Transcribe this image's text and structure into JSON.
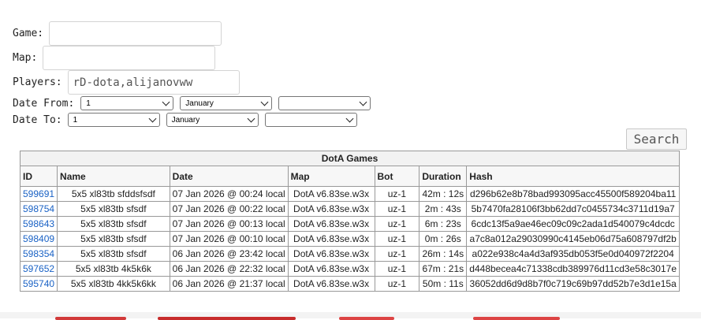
{
  "form": {
    "game_label": "Game:",
    "game_value": "",
    "map_label": "Map:",
    "map_value": "",
    "players_label": "Players:",
    "players_value": "rD-dota,alijanovww",
    "date_from_label": "Date From:",
    "date_from": {
      "day": "1",
      "month": "January",
      "year": ""
    },
    "date_to_label": "Date To:",
    "date_to": {
      "day": "1",
      "month": "January",
      "year": ""
    },
    "search_label": "Search"
  },
  "table": {
    "caption": "DotA Games",
    "headers": [
      "ID",
      "Name",
      "Date",
      "Map",
      "Bot",
      "Duration",
      "Hash"
    ],
    "rows": [
      {
        "id": "599691",
        "name": "5x5 xl83tb sfddsfsdf",
        "date": "07 Jan 2026 @ 00:24 local",
        "map": "DotA v6.83se.w3x",
        "bot": "uz-1",
        "duration": "42m : 12s",
        "hash": "d296b62e8b78bad993095acc45500f589204ba11"
      },
      {
        "id": "598754",
        "name": "5x5 xl83tb sfsdf",
        "date": "07 Jan 2026 @ 00:22 local",
        "map": "DotA v6.83se.w3x",
        "bot": "uz-1",
        "duration": "2m : 43s",
        "hash": "5b7470fa28106f3bb62dd7c0455734c3711d19a7"
      },
      {
        "id": "598643",
        "name": "5x5 xl83tb sfsdf",
        "date": "07 Jan 2026 @ 00:13 local",
        "map": "DotA v6.83se.w3x",
        "bot": "uz-1",
        "duration": "6m : 23s",
        "hash": "6cdc13f5a9ae46ec09c09c2ada1d540079c4dcdc"
      },
      {
        "id": "598409",
        "name": "5x5 xl83tb sfsdf",
        "date": "07 Jan 2026 @ 00:10 local",
        "map": "DotA v6.83se.w3x",
        "bot": "uz-1",
        "duration": "0m : 26s",
        "hash": "a7c8a012a29030990c4145eb06d75a608797df2b"
      },
      {
        "id": "598354",
        "name": "5x5 xl83tb sfsdf",
        "date": "06 Jan 2026 @ 23:42 local",
        "map": "DotA v6.83se.w3x",
        "bot": "uz-1",
        "duration": "26m : 14s",
        "hash": "a022e938c4a4d3af935db053f5e0d040972f2204"
      },
      {
        "id": "597652",
        "name": "5x5 xl83tb 4k5k6k",
        "date": "06 Jan 2026 @ 22:32 local",
        "map": "DotA v6.83se.w3x",
        "bot": "uz-1",
        "duration": "67m : 21s",
        "hash": "d448becea4c71338cdb389976d11cd3e58c3017e"
      },
      {
        "id": "595740",
        "name": "5x5 xl83tb 4kk5k6kk",
        "date": "06 Jan 2026 @ 21:37 local",
        "map": "DotA v6.83se.w3x",
        "bot": "uz-1",
        "duration": "50m : 11s",
        "hash": "36052dd6d9d8b7f0c719c69b97dd52b7e3d1e15a"
      }
    ]
  }
}
